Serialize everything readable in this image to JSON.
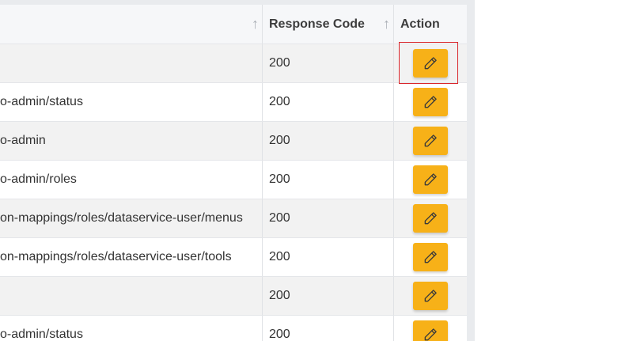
{
  "table": {
    "headers": {
      "path": "",
      "response_code": "Response Code",
      "action": "Action"
    },
    "sort_arrow": "↑",
    "rows": [
      {
        "path": "",
        "code": "200"
      },
      {
        "path": "o-admin/status",
        "code": "200"
      },
      {
        "path": "o-admin",
        "code": "200"
      },
      {
        "path": "o-admin/roles",
        "code": "200"
      },
      {
        "path": "on-mappings/roles/dataservice-user/menus",
        "code": "200"
      },
      {
        "path": "on-mappings/roles/dataservice-user/tools",
        "code": "200"
      },
      {
        "path": "",
        "code": "200"
      },
      {
        "path": "o-admin/status",
        "code": "200"
      }
    ]
  },
  "colors": {
    "edit_button": "#f7b118",
    "highlight": "#d9262b",
    "row_alt": "#f2f2f2"
  },
  "icons": {
    "edit": "pencil-icon"
  }
}
